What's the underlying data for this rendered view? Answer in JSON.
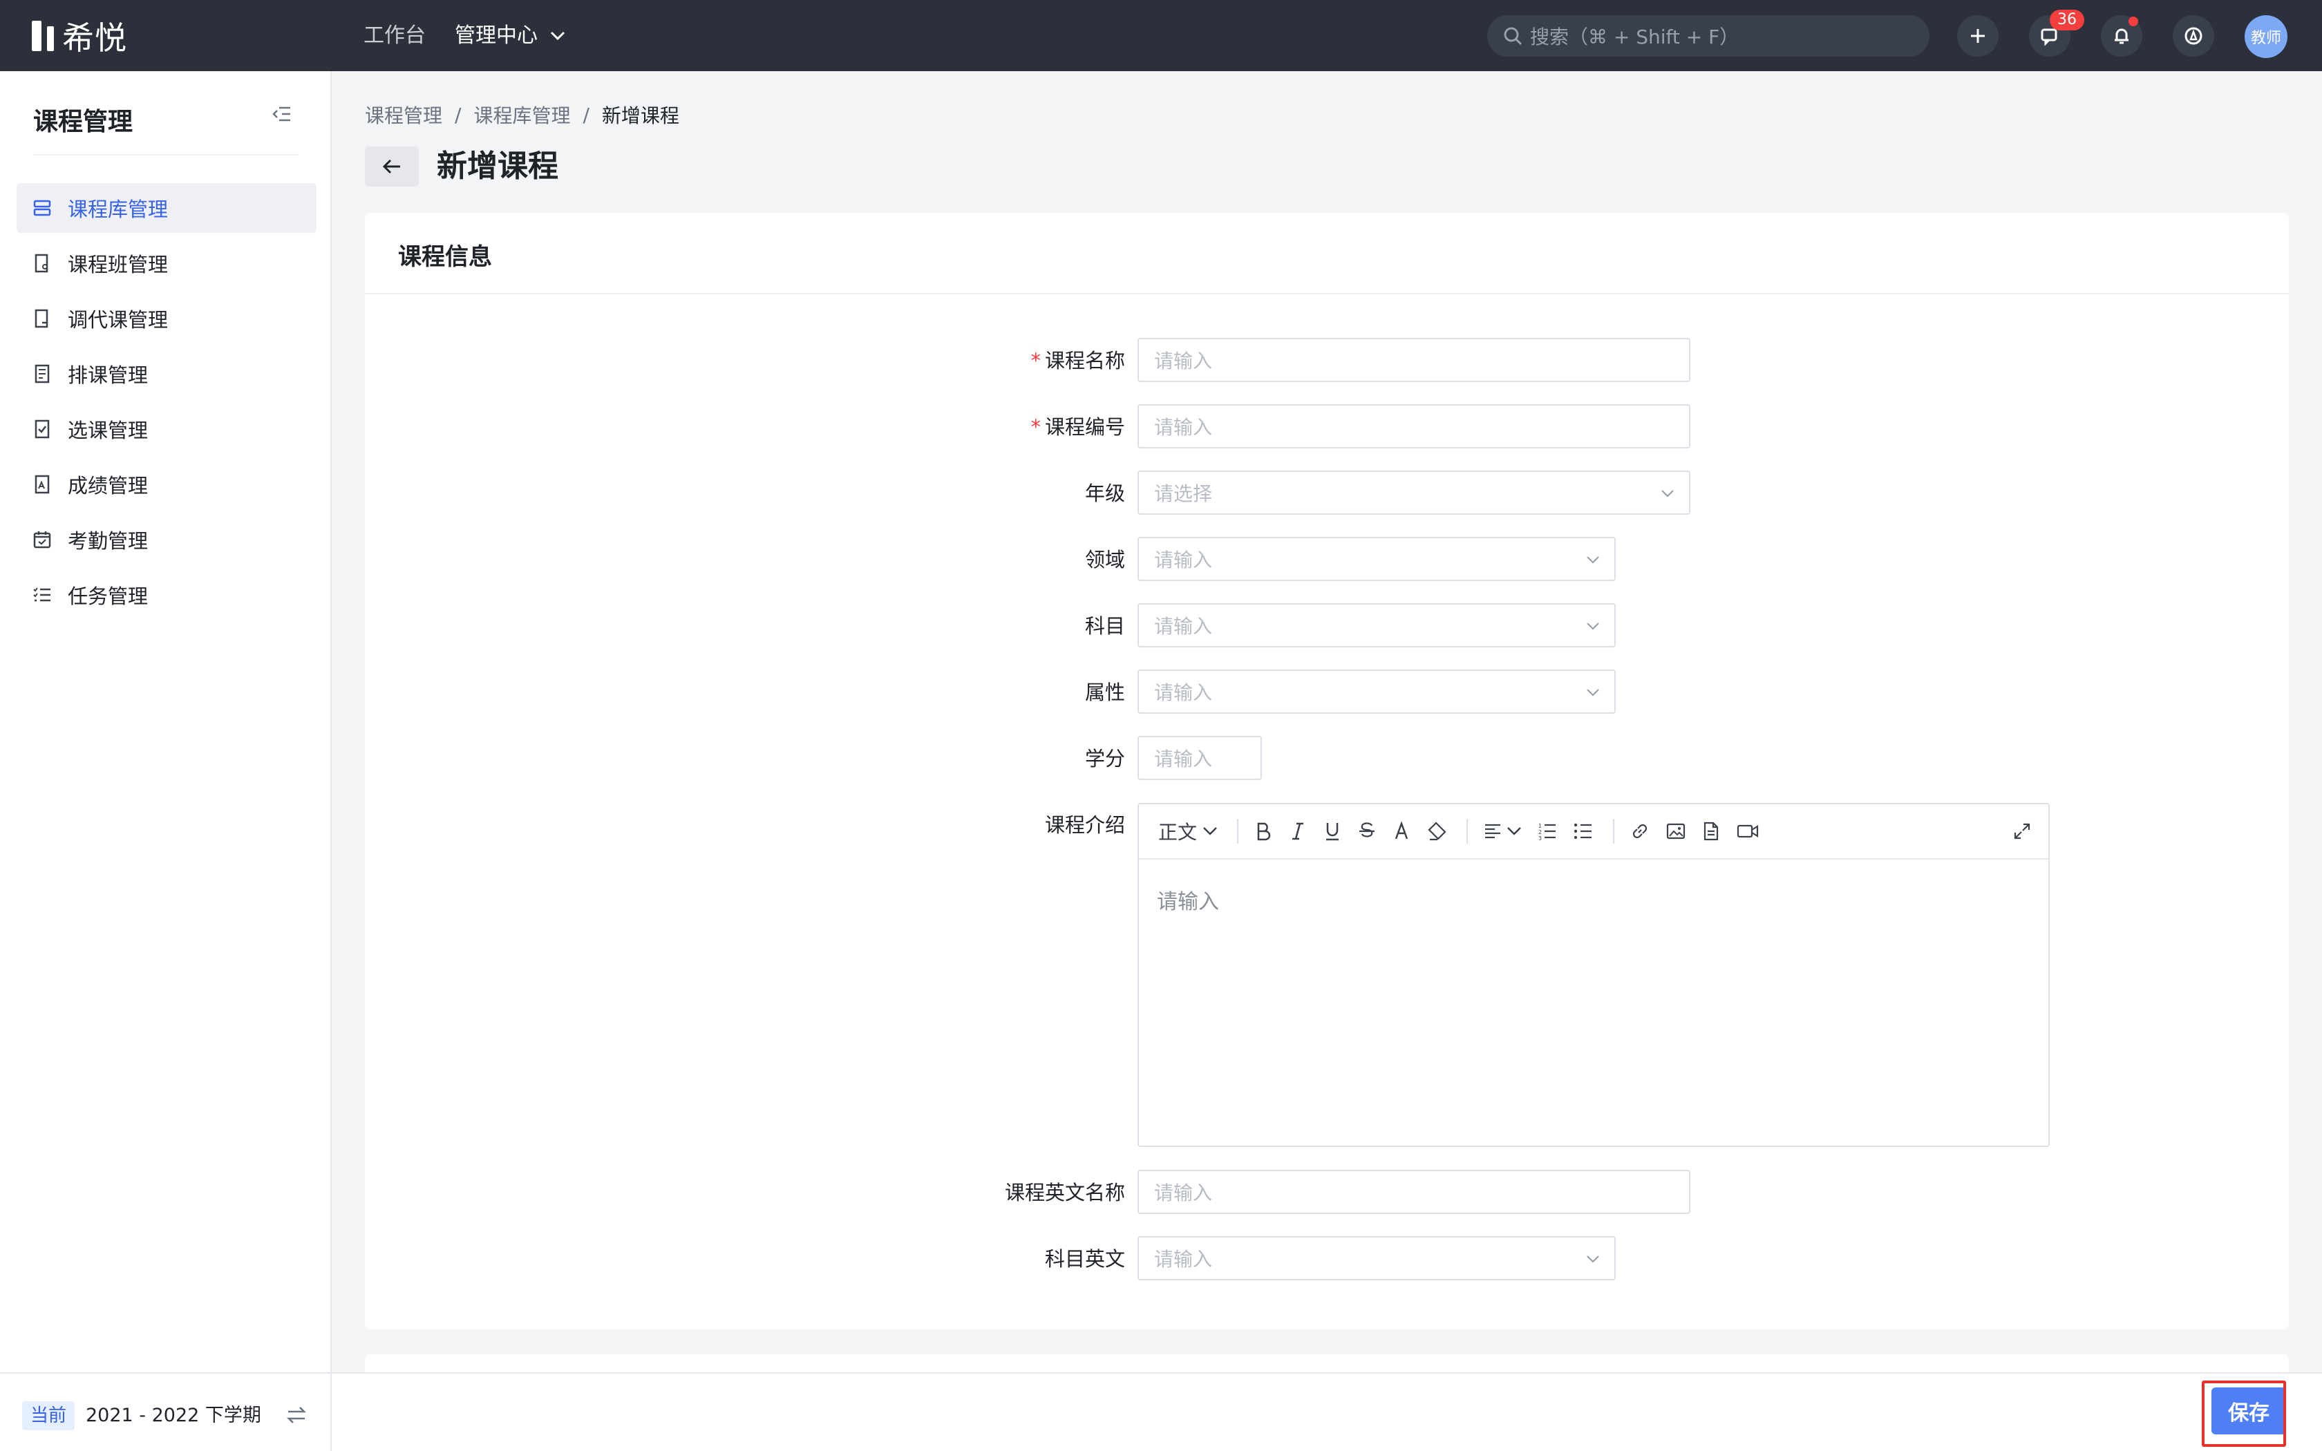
{
  "app": {
    "logo_text": "希悦",
    "nav_workbench": "工作台",
    "nav_admin": "管理中心",
    "search_placeholder": "搜索（⌘ + Shift + F）",
    "messages_count": "36",
    "avatar_text": "教师"
  },
  "sidebar": {
    "title": "课程管理",
    "items": [
      {
        "label": "课程库管理",
        "icon": "stack-icon",
        "active": true
      },
      {
        "label": "课程班管理",
        "icon": "class-doc-icon",
        "active": false
      },
      {
        "label": "调代课管理",
        "icon": "swap-doc-icon",
        "active": false
      },
      {
        "label": "排课管理",
        "icon": "schedule-doc-icon",
        "active": false
      },
      {
        "label": "选课管理",
        "icon": "check-doc-icon",
        "active": false
      },
      {
        "label": "成绩管理",
        "icon": "grade-doc-icon",
        "active": false
      },
      {
        "label": "考勤管理",
        "icon": "calendar-check-icon",
        "active": false
      },
      {
        "label": "任务管理",
        "icon": "task-list-icon",
        "active": false
      }
    ],
    "term_tag": "当前",
    "term_text": "2021 - 2022 下学期"
  },
  "breadcrumb": [
    "课程管理",
    "课程库管理",
    "新增课程"
  ],
  "page_title": "新增课程",
  "card": {
    "title": "课程信息",
    "fields": {
      "course_name": {
        "label": "课程名称",
        "required": "*",
        "placeholder": "请输入"
      },
      "course_code": {
        "label": "课程编号",
        "required": "*",
        "placeholder": "请输入"
      },
      "grade": {
        "label": "年级",
        "placeholder": "请选择"
      },
      "domain": {
        "label": "领域",
        "placeholder": "请输入"
      },
      "subject": {
        "label": "科目",
        "placeholder": "请输入"
      },
      "attribute": {
        "label": "属性",
        "placeholder": "请输入"
      },
      "credit": {
        "label": "学分",
        "placeholder": "请输入"
      },
      "intro": {
        "label": "课程介绍",
        "placeholder": "请输入"
      },
      "english_name": {
        "label": "课程英文名称",
        "placeholder": "请输入"
      },
      "subject_en": {
        "label": "科目英文",
        "placeholder": "请输入"
      }
    },
    "editor_toolbar": {
      "paragraph": "正文"
    }
  },
  "actions": {
    "save": "保存"
  },
  "colors": {
    "topbar": "#2b303a",
    "accent": "#3562e8",
    "save_button": "#4e7ff5",
    "highlight": "#e5332a",
    "badge": "#f53f3f"
  }
}
